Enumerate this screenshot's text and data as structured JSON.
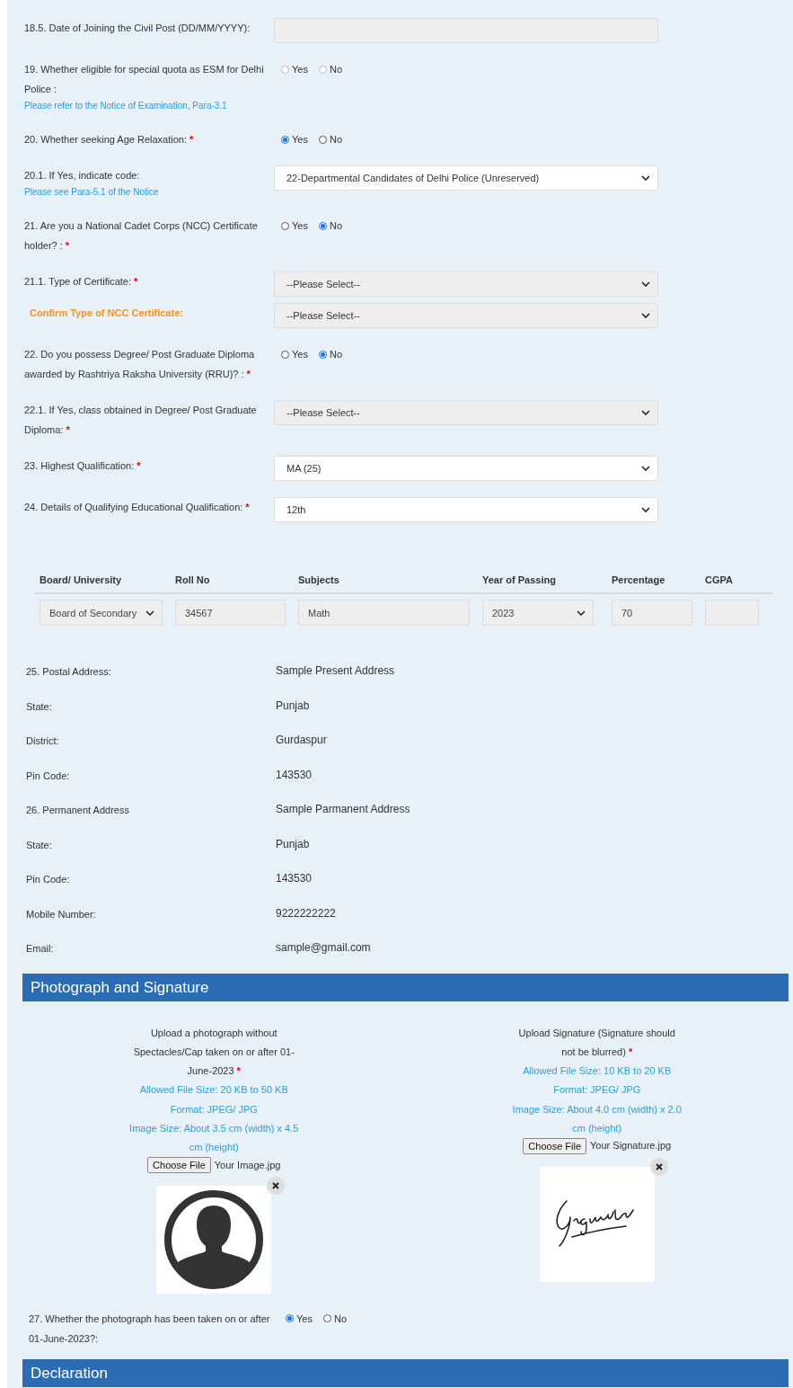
{
  "form_fields": [
    {
      "kind": "text",
      "label": "18.5. Date of Joining the Civil Post (DD/MM/YYYY):",
      "disabled": true
    },
    {
      "kind": "radio",
      "label": "19. Whether eligible for special quota as ESM for Delhi Police :",
      "note": "Please refer to the Notice of Examination, Para-3.1",
      "disabled": true,
      "options": [
        {
          "label": "Yes",
          "selected": false
        },
        {
          "label": "No",
          "selected": false
        }
      ]
    },
    {
      "kind": "radio",
      "label": "20. Whether seeking Age Relaxation:",
      "required_mark": "*",
      "options": [
        {
          "label": "Yes",
          "selected": true
        },
        {
          "label": "No",
          "selected": false
        }
      ]
    },
    {
      "kind": "select",
      "label": "20.1. If Yes, indicate code:",
      "note": "Please see Para-5.1 of the Notice",
      "value": "22-Departmental Candidates of Delhi Police (Unreserved)",
      "disabled": false
    },
    {
      "kind": "radio",
      "label": "21. Are you a National Cadet Corps (NCC) Certificate holder? :",
      "required_mark": "*",
      "options": [
        {
          "label": "Yes",
          "selected": false
        },
        {
          "label": "No",
          "selected": true
        }
      ]
    },
    {
      "kind": "select",
      "label": "21.1. Type of Certificate:",
      "required_mark": "*",
      "value": "--Please Select--",
      "disabled": true
    },
    {
      "kind": "select",
      "label": "Confirm Type of NCC Certificate:",
      "highlight": true,
      "value": "--Please Select--",
      "disabled": true
    },
    {
      "kind": "radio",
      "label": "22. Do you possess Degree/ Post Graduate Diploma awarded by Rashtriya Raksha University (RRU)? :",
      "required_mark": "*",
      "options": [
        {
          "label": "Yes",
          "selected": false
        },
        {
          "label": "No",
          "selected": true
        }
      ]
    },
    {
      "kind": "select",
      "label": "22.1. If Yes, class obtained in Degree/ Post Graduate Diploma:",
      "required_mark": "*",
      "value": "--Please Select--",
      "disabled": true
    },
    {
      "kind": "select",
      "label": "23. Highest Qualification:",
      "required_mark": "*",
      "value": "MA (25)",
      "disabled": false
    },
    {
      "kind": "select",
      "label": "24. Details of Qualifying Educational Qualification:",
      "required_mark": "*",
      "value": "12th",
      "disabled": false
    }
  ],
  "qualification_table": {
    "columns": [
      "Board/ University",
      "Roll No",
      "Subjects",
      "Year of Passing",
      "Percentage",
      "CGPA"
    ],
    "row": [
      {
        "kind": "select",
        "value": "Board of Secondary"
      },
      {
        "kind": "input",
        "value": "34567"
      },
      {
        "kind": "input",
        "value": "Math"
      },
      {
        "kind": "select",
        "value": "2023"
      },
      {
        "kind": "input",
        "value": "70"
      },
      {
        "kind": "input"
      }
    ]
  },
  "address": [
    {
      "label": "25. Postal Address:",
      "value": "Sample Present Address"
    },
    {
      "label": "State:",
      "value": "Punjab"
    },
    {
      "label": "District:",
      "value": "Gurdaspur"
    },
    {
      "label": "Pin Code:",
      "value": "143530"
    },
    {
      "label": "26. Permanent Address",
      "value": "Sample Parmanent Address"
    },
    {
      "label": "State:",
      "value": "Punjab"
    },
    {
      "label": "Pin Code:",
      "value": "143530"
    },
    {
      "label": "Mobile Number:",
      "value": "9222222222"
    },
    {
      "label": "Email:",
      "value": "sample@gmail.com"
    }
  ],
  "photo_section": {
    "title": "Photograph and Signature",
    "uploads": [
      {
        "instructions": "Upload a photograph without Spectacles/Cap taken on or after 01-June-2023",
        "required_mark": "*",
        "notes": [
          "Allowed File Size: 20 KB to 50 KB",
          "Format: JPEG/ JPG",
          "Image Size: About 3.5 cm (width) x 4.5 cm (height)"
        ],
        "button": "Choose File",
        "file_name": "Your Image.jpg",
        "kind": "photo"
      },
      {
        "instructions": "Upload Signature (Signature should not be blurred)",
        "required_mark": "*",
        "notes": [
          "Allowed File Size: 10 KB to 20 KB",
          "Format: JPEG/ JPG",
          "Image Size: About 4.0 cm (width) x 2.0 cm (height)"
        ],
        "button": "Choose File",
        "file_name": "Your Signature.jpg",
        "kind": "signature"
      }
    ]
  },
  "photo_question": {
    "kind": "radio",
    "label": "27. Whether the photograph has been taken on or after 01-June-2023?:",
    "options": [
      {
        "label": "Yes",
        "selected": true
      },
      {
        "label": "No",
        "selected": false
      }
    ]
  },
  "declaration": {
    "title": "Declaration"
  }
}
